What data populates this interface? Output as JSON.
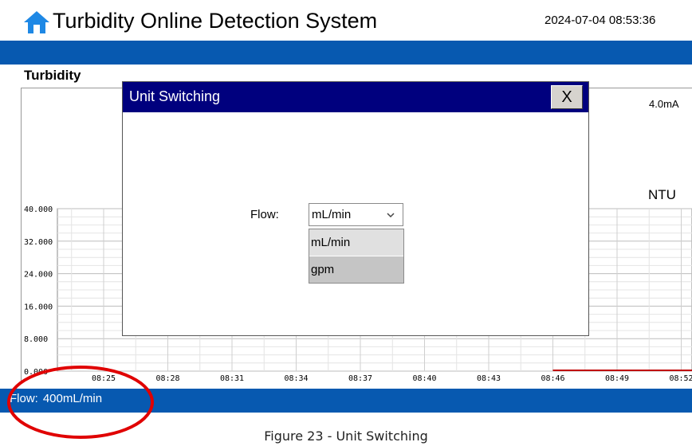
{
  "header": {
    "title": "Turbidity Online Detection System",
    "datetime": "2024-07-04 08:53:36"
  },
  "section_label": "Turbidity",
  "chart": {
    "current_ma": "4.0mA",
    "unit": "NTU",
    "y_ticks": [
      "40.000",
      "32.000",
      "24.000",
      "16.000",
      "8.000",
      "0.000"
    ],
    "x_ticks": [
      "08:25",
      "08:28",
      "08:31",
      "08:34",
      "08:37",
      "08:40",
      "08:43",
      "08:46",
      "08:49",
      "08:52"
    ]
  },
  "chart_data": {
    "type": "line",
    "ylim": [
      0,
      40
    ],
    "y_ticks": [
      40,
      32,
      24,
      16,
      8,
      0
    ],
    "x_ticks": [
      "08:25",
      "08:28",
      "08:31",
      "08:34",
      "08:37",
      "08:40",
      "08:43",
      "08:46",
      "08:49",
      "08:52"
    ],
    "series": [
      {
        "color": "#c00000",
        "x": [
          "08:46",
          "08:53"
        ],
        "values": [
          0,
          0
        ]
      }
    ]
  },
  "dialog": {
    "title": "Unit Switching",
    "close_label": "X",
    "flow_label": "Flow:",
    "flow_value": "mL/min",
    "options": [
      "mL/min",
      "gpm"
    ]
  },
  "status": {
    "flow_label": "Flow:",
    "flow_value": "400mL/min"
  },
  "caption": "Figure 23 - Unit Switching",
  "colors": {
    "bar_blue": "#0759b0",
    "dialog_title_blue": "#00007e",
    "highlight_red": "#e00000",
    "home_icon_blue": "#1e88e5"
  },
  "icons": {
    "home": "home-icon",
    "dropdown": "chevron-down-icon"
  }
}
